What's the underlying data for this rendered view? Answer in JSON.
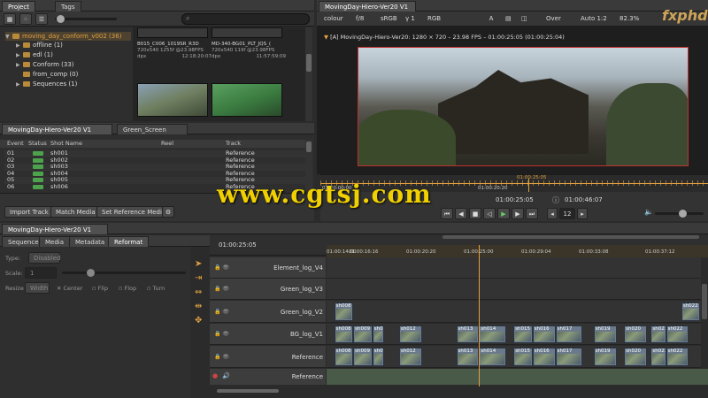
{
  "project_panel": {
    "tabs": [
      "Project",
      "Tags"
    ],
    "search_placeholder": "",
    "tree": [
      {
        "label": "moving_day_conform_v002 (36)",
        "level": 0,
        "expanded": true,
        "selected": true
      },
      {
        "label": "offline (1)",
        "level": 1,
        "expanded": false
      },
      {
        "label": "edl (1)",
        "level": 1,
        "expanded": false
      },
      {
        "label": "Conform (33)",
        "level": 1,
        "expanded": false
      },
      {
        "label": "from_comp (0)",
        "level": 1,
        "expanded": false
      },
      {
        "label": "Sequences (1)",
        "level": 1,
        "expanded": false
      }
    ],
    "thumbs": [
      {
        "name": "B015_C006_1019SR_R3D",
        "info": "720x540   1255f @23.98FPS",
        "fmt": "dpx",
        "tc": "12:18:20:07"
      },
      {
        "name": "MD-340-BG01_PLT_JQS_(",
        "info": "720x540   119f @23.98FPS",
        "fmt": "dpx",
        "tc": "11:57:59:09"
      }
    ]
  },
  "spreadsheet": {
    "tabs": [
      "MovingDay-Hiero-Ver20 V1",
      "Green_Screen"
    ],
    "columns": [
      "Event",
      "Status",
      "Shot Name",
      "Reel",
      "Track"
    ],
    "rows": [
      {
        "event": "01",
        "shot": "sh001",
        "track": "Reference"
      },
      {
        "event": "02",
        "shot": "sh002",
        "track": "Reference"
      },
      {
        "event": "03",
        "shot": "sh003",
        "track": "Reference"
      },
      {
        "event": "04",
        "shot": "sh004",
        "track": "Reference"
      },
      {
        "event": "05",
        "shot": "sh005",
        "track": "Reference"
      },
      {
        "event": "06",
        "shot": "sh006",
        "track": "Reference"
      }
    ],
    "buttons": [
      "Import Track",
      "Match Media",
      "Set Reference Media"
    ]
  },
  "viewer": {
    "tab": "MovingDay-Hiero-Ver20 V1",
    "toolbar": {
      "channel": "colour",
      "fstop": "f/8",
      "colorspace": "sRGB",
      "gamma": "γ 1",
      "mode": "RGB",
      "blend": "Over",
      "resolution": "Auto 1:2",
      "zoom": "82.3%"
    },
    "info": "[A] MovingDay-Hiero-Ver20: 1280 × 720 – 23.98 FPS – 01:00:25:05 (01:00:25:04)",
    "ruler": [
      "01:00:00:00",
      "01:00:20:20",
      "01:00:25:05"
    ],
    "playhead_pct": 35,
    "current_tc": "01:00:25:05",
    "end_tc": "01:00:46:07",
    "frame_step": "12",
    "watermark": "www.cgtsj.com",
    "logo": "fxphd"
  },
  "inspector": {
    "tabs": [
      "Sequence",
      "Media",
      "Metadata",
      "Reformat"
    ],
    "type_label": "Type:",
    "type_value": "Disabled",
    "scale_label": "Scale:",
    "scale_value": "1",
    "resize_label": "Resize",
    "resize_value": "Width",
    "center": "Center",
    "flip": "Flip",
    "flop": "Flop",
    "turn": "Turn"
  },
  "timeline": {
    "tab": "MovingDay-Hiero-Ver20 V1",
    "current_tc": "01:00:25:05",
    "ruler_ticks": [
      "01:00:14:00",
      "01:00:16:16",
      "01:00:20:20",
      "01:00:25:00",
      "01:00:29:04",
      "01:00:33:08",
      "01:00:37:12"
    ],
    "tracks": [
      {
        "name": "Element_log_V4",
        "clips": []
      },
      {
        "name": "Green_log_V3",
        "clips": []
      },
      {
        "name": "Green_log_V2",
        "clips": [
          {
            "label": "sh008",
            "start": 0.02,
            "end": 0.07
          },
          {
            "label": "sh022",
            "start": 0.93,
            "end": 0.98
          }
        ]
      },
      {
        "name": "BG_log_V1",
        "clips": [
          {
            "label": "sh008",
            "start": 0.02,
            "end": 0.07
          },
          {
            "label": "sh009",
            "start": 0.07,
            "end": 0.12
          },
          {
            "label": "sh0",
            "start": 0.12,
            "end": 0.15
          },
          {
            "label": "sh012",
            "start": 0.19,
            "end": 0.25
          },
          {
            "label": "sh013",
            "start": 0.34,
            "end": 0.4
          },
          {
            "label": "sh014",
            "start": 0.4,
            "end": 0.47
          },
          {
            "label": "sh015",
            "start": 0.49,
            "end": 0.54
          },
          {
            "label": "sh016",
            "start": 0.54,
            "end": 0.6
          },
          {
            "label": "sh017",
            "start": 0.6,
            "end": 0.67
          },
          {
            "label": "sh019",
            "start": 0.7,
            "end": 0.76
          },
          {
            "label": "sh020",
            "start": 0.78,
            "end": 0.84
          },
          {
            "label": "sh021",
            "start": 0.85,
            "end": 0.89
          },
          {
            "label": "sh022",
            "start": 0.89,
            "end": 0.95
          }
        ]
      },
      {
        "name": "Reference",
        "clips": [
          {
            "label": "sh008",
            "start": 0.02,
            "end": 0.07
          },
          {
            "label": "sh009",
            "start": 0.07,
            "end": 0.12
          },
          {
            "label": "sh0",
            "start": 0.12,
            "end": 0.15
          },
          {
            "label": "sh012",
            "start": 0.19,
            "end": 0.25
          },
          {
            "label": "sh013",
            "start": 0.34,
            "end": 0.4
          },
          {
            "label": "sh014",
            "start": 0.4,
            "end": 0.47
          },
          {
            "label": "sh015",
            "start": 0.49,
            "end": 0.54
          },
          {
            "label": "sh016",
            "start": 0.54,
            "end": 0.6
          },
          {
            "label": "sh017",
            "start": 0.6,
            "end": 0.67
          },
          {
            "label": "sh019",
            "start": 0.7,
            "end": 0.76
          },
          {
            "label": "sh020",
            "start": 0.78,
            "end": 0.84
          },
          {
            "label": "sh021",
            "start": 0.85,
            "end": 0.89
          },
          {
            "label": "sh022",
            "start": 0.89,
            "end": 0.95
          }
        ]
      }
    ],
    "audio_track": "Reference",
    "playhead_pct": 0.4
  }
}
